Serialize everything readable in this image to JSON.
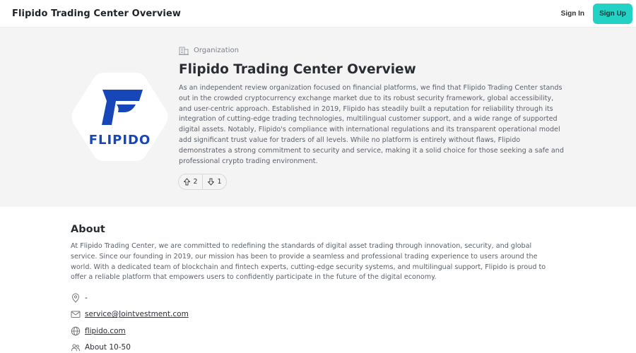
{
  "header": {
    "brand": "Flipido Trading Center Overview",
    "sign_in": "Sign In",
    "sign_up": "Sign Up"
  },
  "hero": {
    "category": "Organization",
    "title": "Flipido Trading Center Overview",
    "description": "As an independent review organization focused on financial platforms, we find that Flipido Trading Center stands out in the crowded cryptocurrency exchange market due to its robust security framework, global accessibility, and user-centric approach. Established in 2019, Flipido has steadily built a reputation for reliability through its integration of cutting-edge trading technologies, multilingual customer support, and a wide range of supported digital assets. Notably, Flipido's compliance with international regulations and its transparent operational model add significant trust value for traders of all levels. While no platform is entirely without flaws, Flipido demonstrates a strong commitment to security and service, making it a solid choice for those seeking a safe and professional crypto trading environment.",
    "logo_text": "FLIPIDO",
    "upvotes": "2",
    "downvotes": "1"
  },
  "about": {
    "title": "About",
    "text": "At Flipido Trading Center, we are committed to redefining the standards of digital asset trading through innovation, security, and global service. Since our founding in 2019, our mission has been to provide a seamless and professional trading experience to users around the world. With a dedicated team of blockchain and fintech experts, cutting-edge security systems, and multilingual support, Flipido is proud to offer a reliable platform that empowers users to confidently participate in the future of the digital economy.",
    "location": "-",
    "email": "service@Jointvestment.com",
    "website": "flipido.com",
    "size": "About 10-50"
  },
  "colors": {
    "accent": "#22d3c5",
    "logo_blue": "#1646b8",
    "hero_bg": "#f4f4f5"
  },
  "icons": {
    "category": "building-icon",
    "upvote": "arrow-up-icon",
    "downvote": "arrow-down-icon",
    "location": "map-pin-icon",
    "email": "mail-icon",
    "website": "globe-icon",
    "size": "users-icon"
  }
}
